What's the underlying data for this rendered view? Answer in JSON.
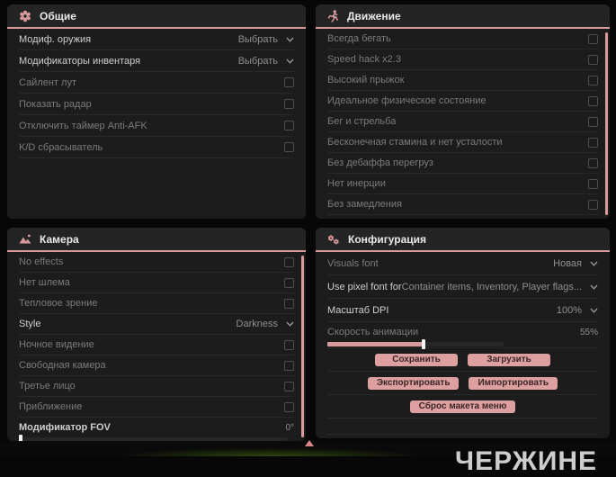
{
  "colors": {
    "accent": "#d89a9a",
    "button_bg": "#dd9f9f",
    "panel_bg": "#1c1c1c"
  },
  "background_text": "ЧЕРЖИНЕ",
  "panels": [
    {
      "id": "general",
      "title": "Общие",
      "icon": "flower-gear-icon",
      "scrollbar": false,
      "rows": [
        {
          "type": "dropdown",
          "label": "Модиф. оружия",
          "value": "Выбрать",
          "bright": true
        },
        {
          "type": "dropdown",
          "label": "Модификаторы инвентаря",
          "value": "Выбрать",
          "bright": true
        },
        {
          "type": "checkbox",
          "label": "Сайлент лут",
          "checked": false
        },
        {
          "type": "checkbox",
          "label": "Показать радар",
          "checked": false
        },
        {
          "type": "checkbox",
          "label": "Отключить таймер Anti-AFK",
          "checked": false
        },
        {
          "type": "checkbox",
          "label": "K/D сбрасыватель",
          "checked": false
        }
      ]
    },
    {
      "id": "movement",
      "title": "Движение",
      "icon": "runner-icon",
      "scrollbar": true,
      "rows": [
        {
          "type": "checkbox",
          "label": "Всегда бегать",
          "checked": false
        },
        {
          "type": "checkbox",
          "label": "Speed hack x2.3",
          "checked": false
        },
        {
          "type": "checkbox",
          "label": "Высокий прыжок",
          "checked": false
        },
        {
          "type": "checkbox",
          "label": "Идеальное физическое состояние",
          "checked": false
        },
        {
          "type": "checkbox",
          "label": "Бег и стрельба",
          "checked": false
        },
        {
          "type": "checkbox",
          "label": "Бесконечная стамина и нет усталости",
          "checked": false
        },
        {
          "type": "checkbox",
          "label": "Без дебаффа перегруз",
          "checked": false
        },
        {
          "type": "checkbox",
          "label": "Нет инерции",
          "checked": false
        },
        {
          "type": "checkbox",
          "label": "Без замедления",
          "checked": false
        }
      ]
    },
    {
      "id": "camera",
      "title": "Камера",
      "icon": "image-icon",
      "scrollbar": true,
      "rows": [
        {
          "type": "checkbox",
          "label": "No effects",
          "checked": false
        },
        {
          "type": "checkbox",
          "label": "Нет шлема",
          "checked": false
        },
        {
          "type": "checkbox",
          "label": "Тепловое зрение",
          "checked": false
        },
        {
          "type": "dropdown",
          "label": "Style",
          "value": "Darkness",
          "bright": true
        },
        {
          "type": "checkbox",
          "label": "Ночное видение",
          "checked": false
        },
        {
          "type": "checkbox",
          "label": "Свободная камера",
          "checked": false
        },
        {
          "type": "checkbox",
          "label": "Третье лицо",
          "checked": false
        },
        {
          "type": "checkbox",
          "label": "Приближение",
          "checked": false
        },
        {
          "type": "slider",
          "label": "Модификатор FOV",
          "value": "0°",
          "percent": 0,
          "bright": true
        }
      ]
    },
    {
      "id": "config",
      "title": "Конфигурация",
      "icon": "gears-icon",
      "scrollbar": false,
      "rows": [
        {
          "type": "dropdown",
          "label": "Visuals font",
          "value": "Новая"
        },
        {
          "type": "dropdown",
          "label": "Use pixel font for",
          "value": "Container items, Inventory, Player flags...",
          "bright": true
        },
        {
          "type": "dropdown",
          "label": "Масштаб DPI",
          "value": "100%",
          "bright": true
        },
        {
          "type": "slider",
          "label": "Скорость анимации",
          "value": "55%",
          "percent": 55
        }
      ],
      "button_rows": [
        [
          "Сохранить",
          "Загрузить"
        ],
        [
          "Экспортировать",
          "Импортировать"
        ],
        [
          "Сброс макета меню"
        ]
      ]
    }
  ]
}
